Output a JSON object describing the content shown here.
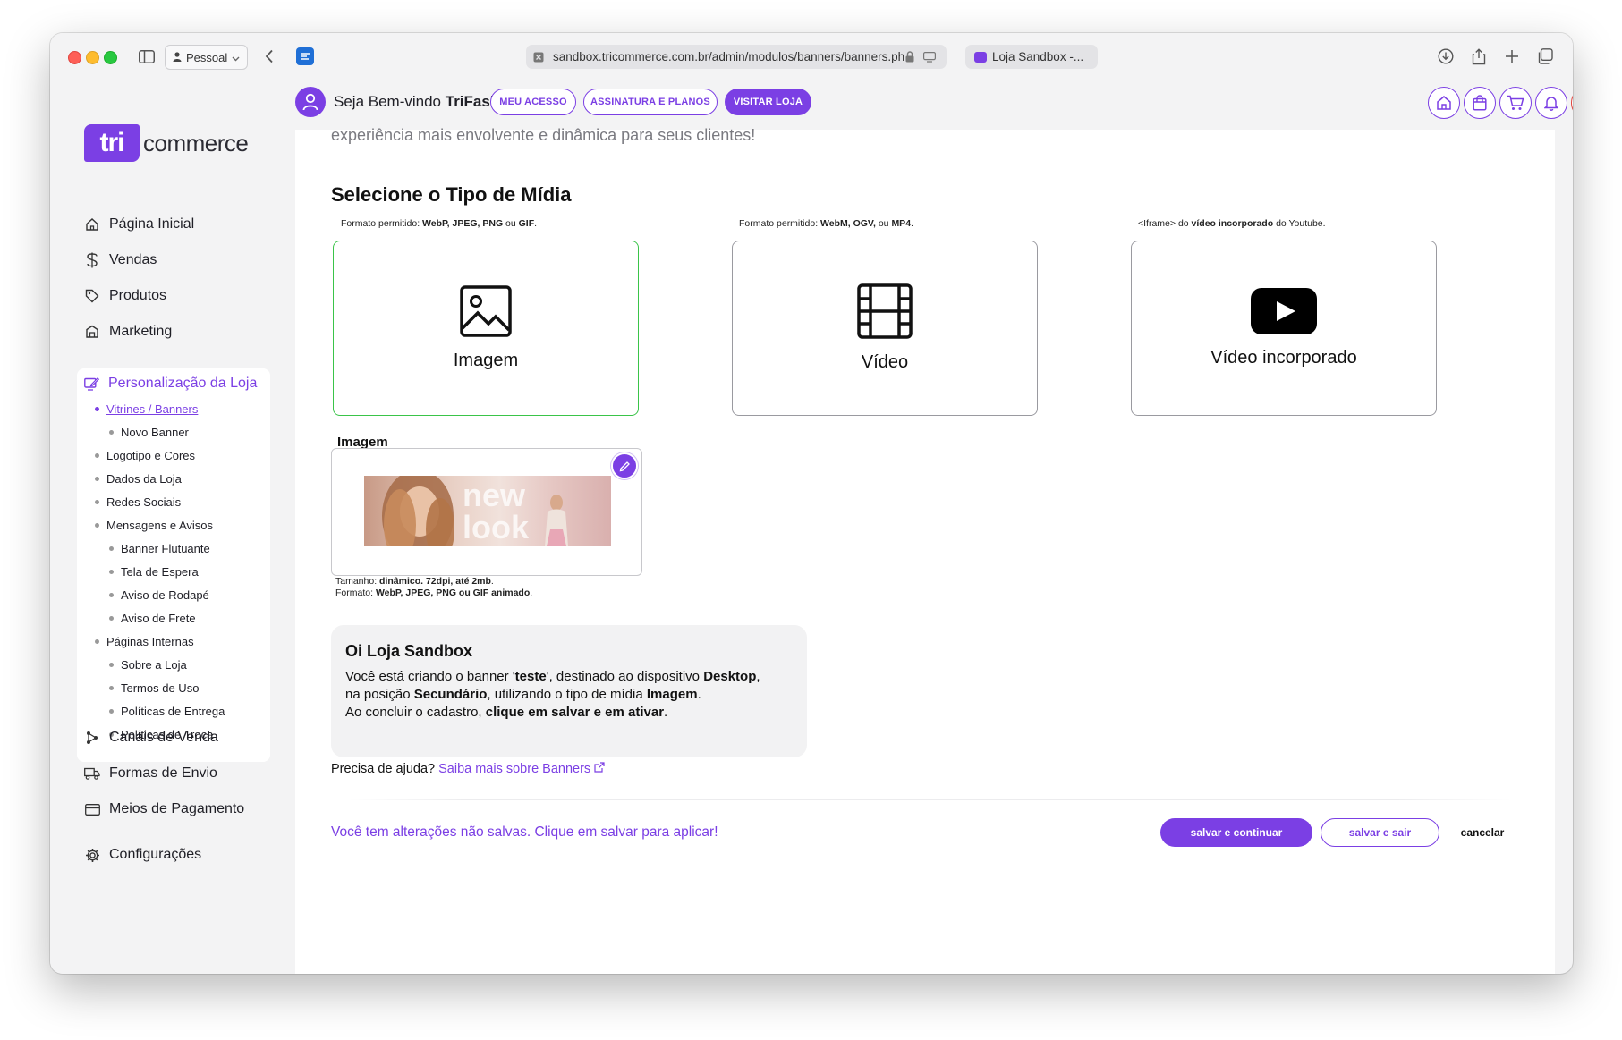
{
  "browser": {
    "profile_label": "Pessoal",
    "url": "sandbox.tricommerce.com.br/admin/modulos/banners/banners.ph",
    "tab_title": "Loja Sandbox -..."
  },
  "logo": {
    "mark": "tri",
    "text": "commerce"
  },
  "sidebar": {
    "items": [
      {
        "label": "Página Inicial",
        "icon": "home-icon"
      },
      {
        "label": "Vendas",
        "icon": "dollar-icon"
      },
      {
        "label": "Produtos",
        "icon": "tag-icon"
      },
      {
        "label": "Marketing",
        "icon": "megaphone-icon"
      }
    ],
    "section": {
      "label": "Personalização da Loja",
      "icon": "edit-screen-icon",
      "subitems": [
        {
          "label": "Vitrines / Banners",
          "level": 1,
          "active": true
        },
        {
          "label": "Novo Banner",
          "level": 2
        },
        {
          "label": "Logotipo e Cores",
          "level": 1
        },
        {
          "label": "Dados da Loja",
          "level": 1
        },
        {
          "label": "Redes Sociais",
          "level": 1
        },
        {
          "label": "Mensagens e Avisos",
          "level": 1
        },
        {
          "label": "Banner Flutuante",
          "level": 2
        },
        {
          "label": "Tela de Espera",
          "level": 2
        },
        {
          "label": "Aviso de Rodapé",
          "level": 2
        },
        {
          "label": "Aviso de Frete",
          "level": 2
        },
        {
          "label": "Páginas Internas",
          "level": 1
        },
        {
          "label": "Sobre a Loja",
          "level": 2
        },
        {
          "label": "Termos de Uso",
          "level": 2
        },
        {
          "label": "Políticas de Entrega",
          "level": 2
        },
        {
          "label": "Políticas de Troca",
          "level": 2
        }
      ]
    },
    "bottom_items": [
      {
        "label": "Canais de Venda",
        "icon": "channels-icon"
      },
      {
        "label": "Formas de Envio",
        "icon": "truck-icon"
      },
      {
        "label": "Meios de Pagamento",
        "icon": "card-icon"
      },
      {
        "label": "Configurações",
        "icon": "gear-icon"
      }
    ]
  },
  "header": {
    "welcome_prefix": "Seja Bem-vindo",
    "welcome_name": "TriFashion",
    "buttons": {
      "meu_acesso": "MEU ACESSO",
      "assinatura": "ASSINATURA E PLANOS",
      "visitar": "VISITAR LOJA"
    }
  },
  "content": {
    "intro": "experiência mais envolvente e dinâmica para seus clientes!",
    "section_title": "Selecione o Tipo de Mídia",
    "notes": {
      "image": {
        "prefix": "Formato permitido:",
        "bold": "WebP, JPEG, PNG",
        "mid": "ou",
        "bold2": "GIF",
        "end": "."
      },
      "video": {
        "prefix": "Formato permitido:",
        "bold": "WebM, OGV,",
        "mid": "ou",
        "bold2": "MP4",
        "end": "."
      },
      "embed": {
        "prefix": "<Iframe> do",
        "bold": "vídeo incorporado",
        "mid": "do Youtube.",
        "bold2": "",
        "end": ""
      }
    },
    "media_cards": {
      "image": "Imagem",
      "video": "Vídeo",
      "embed": "Vídeo incorporado"
    },
    "image_label": "Imagem",
    "image_info": {
      "size_prefix": "Tamanho:",
      "size_value": "dinâmico. 72dpi, até 2mb",
      "format_prefix": "Formato:",
      "format_value": "WebP, JPEG, PNG ou GIF animado"
    },
    "banner_overlay_text": "new look",
    "message": {
      "title": "Oi Loja Sandbox",
      "l1_a": "Você está criando o banner '",
      "l1_b": "teste",
      "l1_c": "', destinado ao dispositivo ",
      "l1_d": "Desktop",
      "l1_e": ",",
      "l2_a": "na posição ",
      "l2_b": "Secundário",
      "l2_c": ", utilizando o tipo de mídia ",
      "l2_d": "Imagem",
      "l2_e": ".",
      "l3_a": "Ao concluir o cadastro, ",
      "l3_b": "clique em salvar e em ativar",
      "l3_c": "."
    },
    "help_prefix": "Precisa de ajuda?",
    "help_link": "Saiba mais sobre Banners",
    "unsaved": "Você tem alterações não salvas. Clique em salvar para aplicar!",
    "actions": {
      "save_continue": "salvar e continuar",
      "save_exit": "salvar e sair",
      "cancel": "cancelar"
    }
  },
  "colors": {
    "accent": "#7b3fe4",
    "selected_border": "#3ac449",
    "danger": "#e0443e"
  }
}
